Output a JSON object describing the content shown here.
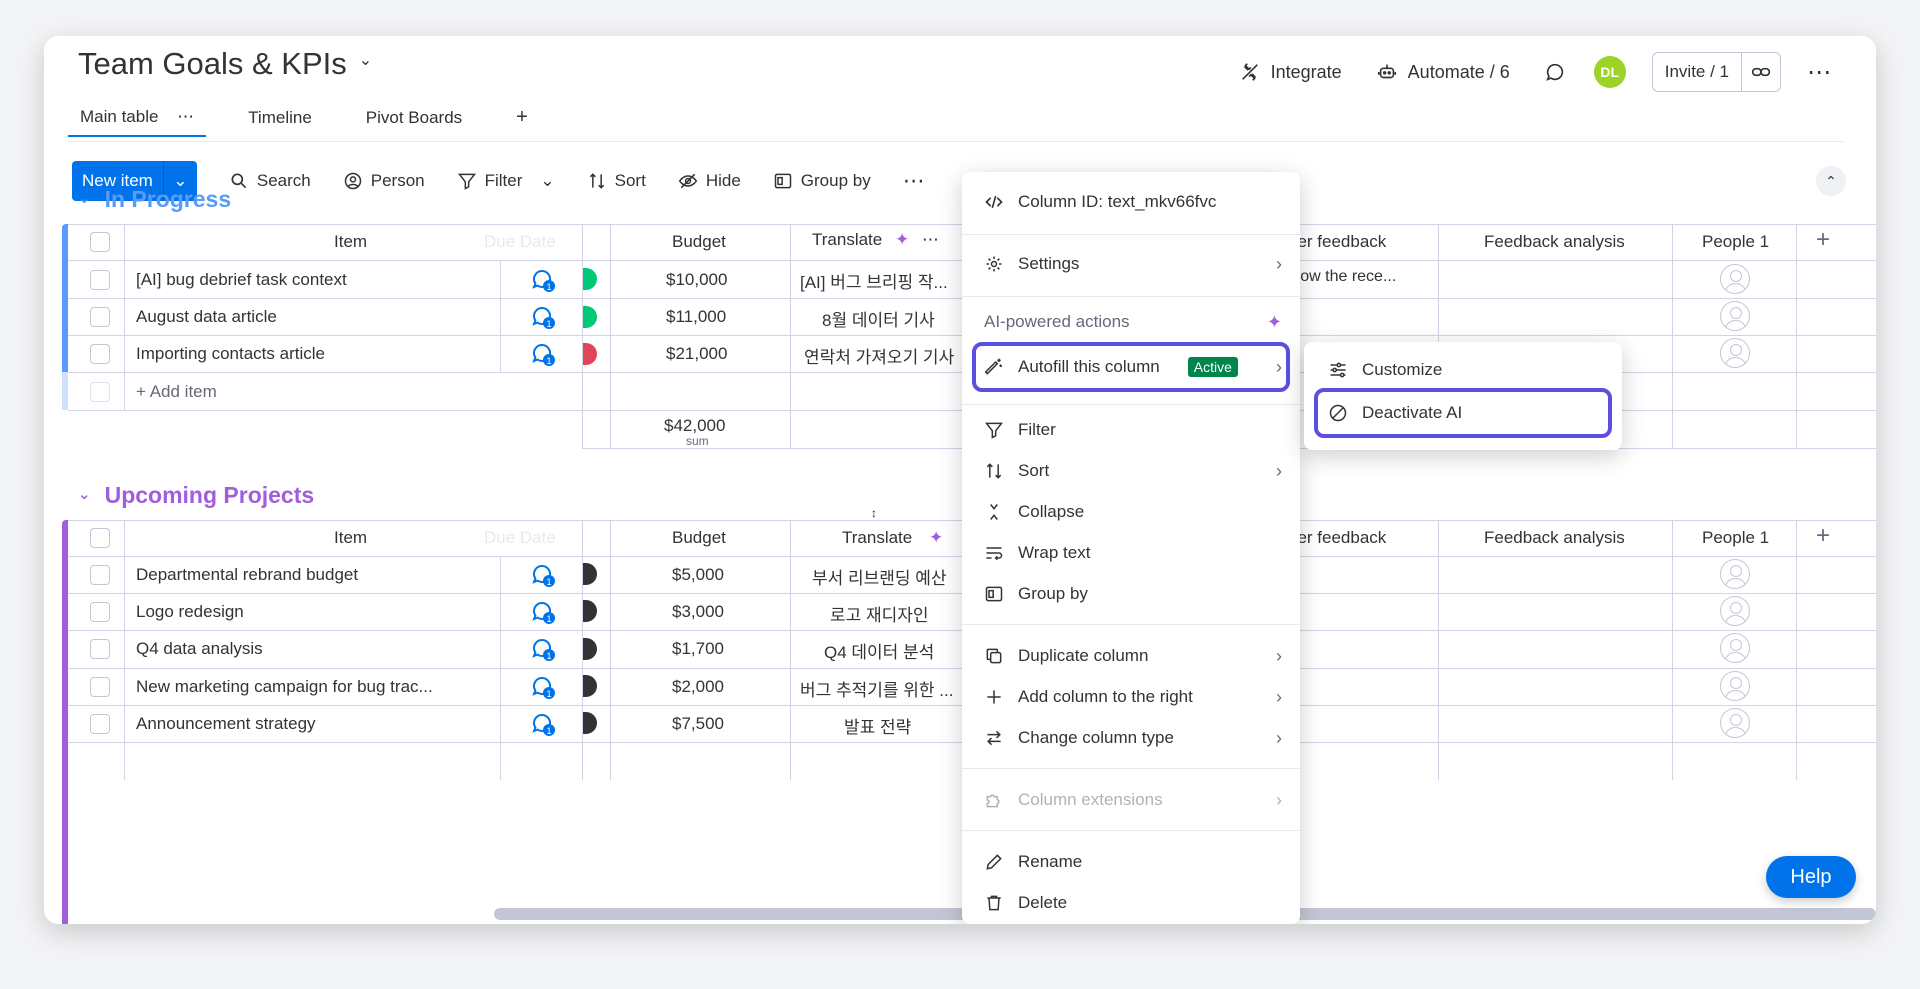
{
  "header": {
    "board_title": "Team Goals & KPIs",
    "integrate": "Integrate",
    "automate": "Automate / 6",
    "avatar_initials": "DL",
    "invite": "Invite / 1"
  },
  "tabs": [
    {
      "label": "Main table"
    },
    {
      "label": "Timeline"
    },
    {
      "label": "Pivot Boards"
    },
    {
      "label": "+"
    }
  ],
  "toolbar": {
    "new_item": "New item",
    "search": "Search",
    "person": "Person",
    "filter": "Filter",
    "sort": "Sort",
    "hide": "Hide",
    "group_by": "Group by"
  },
  "columns": {
    "item": "Item",
    "due_date": "Due Date",
    "budget": "Budget",
    "translate": "Translate",
    "manager_feedback": "ger feedback",
    "feedback_analysis": "Feedback analysis",
    "people": "People 1"
  },
  "groups": [
    {
      "title": "In Progress",
      "color": "#579bfc",
      "rows": [
        {
          "item": "[AI] bug debrief task context",
          "budget": "$10,000",
          "translate": "[AI] 버그 브리핑 작...",
          "status_color": "#00c875",
          "feedback": "...how the rece..."
        },
        {
          "item": "August data article",
          "budget": "$11,000",
          "translate": "8월 데이터 기사",
          "status_color": "#00c875",
          "feedback": ""
        },
        {
          "item": "Importing contacts article",
          "budget": "$21,000",
          "translate": "연락처 가져오기 기사",
          "status_color": "#e2445c",
          "feedback": ""
        }
      ],
      "add_item": "+ Add item",
      "sum_value": "$42,000",
      "sum_label": "sum"
    },
    {
      "title": "Upcoming Projects",
      "color": "#a25ddc",
      "rows": [
        {
          "item": "Departmental rebrand budget",
          "budget": "$5,000",
          "translate": "부서 리브랜딩 예산",
          "status_color": "#333333"
        },
        {
          "item": "Logo redesign",
          "budget": "$3,000",
          "translate": "로고 재디자인",
          "status_color": "#333333"
        },
        {
          "item": "Q4 data analysis",
          "budget": "$1,700",
          "translate": "Q4 데이터 분석",
          "status_color": "#333333"
        },
        {
          "item": "New marketing campaign for bug trac...",
          "budget": "$2,000",
          "translate": "버그 추적기를 위한 ...",
          "status_color": "#333333"
        },
        {
          "item": "Announcement strategy",
          "budget": "$7,500",
          "translate": "발표 전략",
          "status_color": "#333333"
        }
      ]
    }
  ],
  "update_badge": "1",
  "column_menu": {
    "column_id": "Column ID: text_mkv66fvc",
    "settings": "Settings",
    "ai_section": "AI-powered actions",
    "autofill": "Autofill this column",
    "active_badge": "Active",
    "filter": "Filter",
    "sort": "Sort",
    "collapse": "Collapse",
    "wrap_text": "Wrap text",
    "group_by": "Group by",
    "duplicate": "Duplicate column",
    "add_right": "Add column to the right",
    "change_type": "Change column type",
    "extensions": "Column extensions",
    "rename": "Rename",
    "delete": "Delete"
  },
  "submenu": {
    "customize": "Customize",
    "deactivate": "Deactivate AI"
  },
  "help": "Help",
  "colors": {
    "primary": "#0073ea",
    "highlight": "#5c4fe0",
    "active_badge": "#00854d"
  }
}
